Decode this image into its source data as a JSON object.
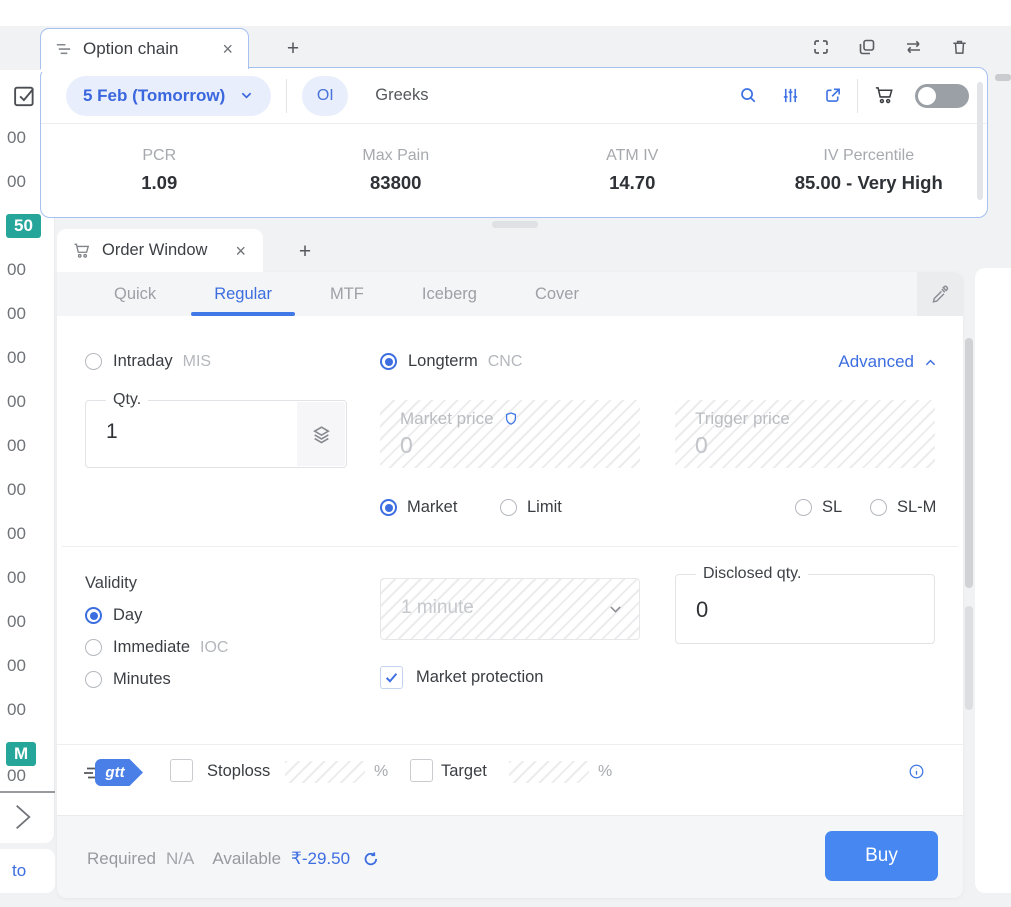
{
  "colors": {
    "accent": "#3d6ee0",
    "teal": "#26a69a",
    "buy_button": "#4787f1",
    "panel_border": "#a6c0f2"
  },
  "window": {
    "add_tab": "+",
    "close": "×"
  },
  "top_tabs": {
    "option_chain": "Option chain"
  },
  "option_chain": {
    "expiry": "5 Feb (Tomorrow)",
    "oi_toggle": "OI",
    "greeks": "Greeks",
    "stats": [
      {
        "label": "PCR",
        "value": "1.09"
      },
      {
        "label": "Max Pain",
        "value": "83800"
      },
      {
        "label": "ATM IV",
        "value": "14.70"
      },
      {
        "label": "IV Percentile",
        "value": "85.00 - Very High"
      }
    ]
  },
  "strike_rail": {
    "rows": [
      {
        "t": "00"
      },
      {
        "t": "00"
      },
      {
        "t": "50",
        "k": "atm"
      },
      {
        "t": "00"
      },
      {
        "t": "00"
      },
      {
        "t": "00"
      },
      {
        "t": "00"
      },
      {
        "t": "00"
      },
      {
        "t": "00"
      },
      {
        "t": "00"
      },
      {
        "t": "00"
      },
      {
        "t": "00"
      },
      {
        "t": "00"
      },
      {
        "t": "00"
      },
      {
        "t": "M",
        "k": "atm"
      }
    ],
    "tail": "00",
    "link": "to"
  },
  "order_window": {
    "tab_title": "Order Window",
    "tabs": [
      {
        "label": "Quick"
      },
      {
        "label": "Regular",
        "active": true
      },
      {
        "label": "MTF"
      },
      {
        "label": "Iceberg"
      },
      {
        "label": "Cover"
      }
    ],
    "product": {
      "intraday": "Intraday",
      "intraday_tag": "MIS",
      "longterm": "Longterm",
      "longterm_tag": "CNC",
      "advanced": "Advanced"
    },
    "qty": {
      "label": "Qty.",
      "value": "1"
    },
    "market_price": {
      "label": "Market price",
      "value": "0"
    },
    "trigger_price": {
      "label": "Trigger price",
      "value": "0"
    },
    "order_types": {
      "market": "Market",
      "limit": "Limit",
      "sl": "SL",
      "slm": "SL-M"
    },
    "validity": {
      "title": "Validity",
      "day": "Day",
      "immediate": "Immediate",
      "immediate_tag": "IOC",
      "minutes": "Minutes"
    },
    "minute_select": "1 minute",
    "disclosed": {
      "label": "Disclosed qty.",
      "value": "0"
    },
    "market_protection": "Market protection",
    "gtt": {
      "logo": "gtt",
      "stoploss": "Stoploss",
      "target": "Target",
      "percent": "%"
    },
    "footer": {
      "required_label": "Required",
      "required_value": "N/A",
      "available_label": "Available",
      "available_value": "₹-29.50",
      "buy": "Buy"
    }
  }
}
